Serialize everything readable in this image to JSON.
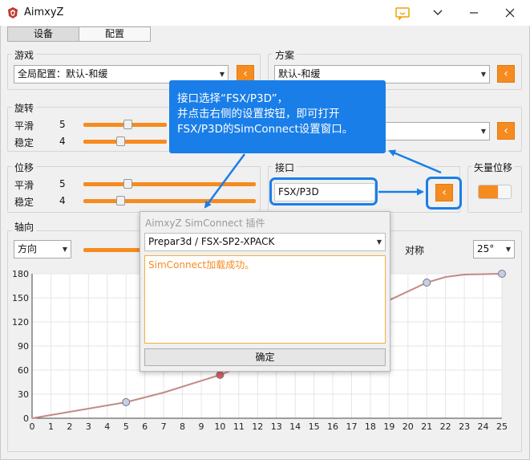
{
  "window": {
    "title": "AimxyZ"
  },
  "tabs": [
    {
      "label": "设备"
    },
    {
      "label": "配置"
    }
  ],
  "game": {
    "label": "游戏",
    "value": "全局配置：默认-和缓"
  },
  "scheme": {
    "label": "方案",
    "value": "默认-和缓"
  },
  "rotation": {
    "label": "旋转",
    "smooth_label": "平滑",
    "smooth_value": "5",
    "smooth_level": 5,
    "steady_label": "稳定",
    "steady_value": "4",
    "steady_level": 4
  },
  "displacement": {
    "label": "位移",
    "smooth_label": "平滑",
    "smooth_value": "5",
    "smooth_level": 5,
    "steady_label": "稳定",
    "steady_value": "4",
    "steady_level": 4
  },
  "interface": {
    "label": "接口",
    "value": "FSX/P3D"
  },
  "vector": {
    "label": "矢量位移",
    "enabled": true
  },
  "axis": {
    "label": "轴向",
    "direction_value": "方向",
    "symmetric_label": "对称",
    "angle_value": "25°"
  },
  "tooltip": {
    "line1": "接口选择“FSX/P3D”，",
    "line2": "并点击右侧的设置按钮，即可打开",
    "line3": "FSX/P3D的SimConnect设置窗口。"
  },
  "dialog": {
    "title": "AimxyZ SimConnect 插件",
    "select_value": "Prepar3d / FSX-SP2-XPACK",
    "message": "SimConnect加载成功。",
    "ok_label": "确定"
  },
  "colors": {
    "accent": "#f68b1f",
    "callout": "#1a7ee8",
    "curve": "#c48a84"
  },
  "chart_data": {
    "type": "line",
    "x_ticks": [
      0,
      1,
      2,
      3,
      4,
      5,
      6,
      7,
      8,
      9,
      10,
      11,
      12,
      13,
      14,
      15,
      16,
      17,
      18,
      19,
      20,
      21,
      22,
      23,
      24,
      25
    ],
    "y_ticks": [
      0,
      30,
      60,
      90,
      120,
      150,
      180
    ],
    "xlim": [
      0,
      25
    ],
    "ylim": [
      0,
      180
    ],
    "control_points": [
      {
        "x": 5,
        "y": 20
      },
      {
        "x": 10,
        "y": 54
      },
      {
        "x": 21,
        "y": 169
      },
      {
        "x": 25,
        "y": 180
      }
    ],
    "curve": [
      {
        "x": 0,
        "y": 0
      },
      {
        "x": 2,
        "y": 8
      },
      {
        "x": 4,
        "y": 16
      },
      {
        "x": 5,
        "y": 20
      },
      {
        "x": 7,
        "y": 32
      },
      {
        "x": 10,
        "y": 54
      },
      {
        "x": 13,
        "y": 82
      },
      {
        "x": 16,
        "y": 113
      },
      {
        "x": 18,
        "y": 136
      },
      {
        "x": 21,
        "y": 169
      },
      {
        "x": 22,
        "y": 176
      },
      {
        "x": 23,
        "y": 179
      },
      {
        "x": 25,
        "y": 180
      }
    ]
  }
}
